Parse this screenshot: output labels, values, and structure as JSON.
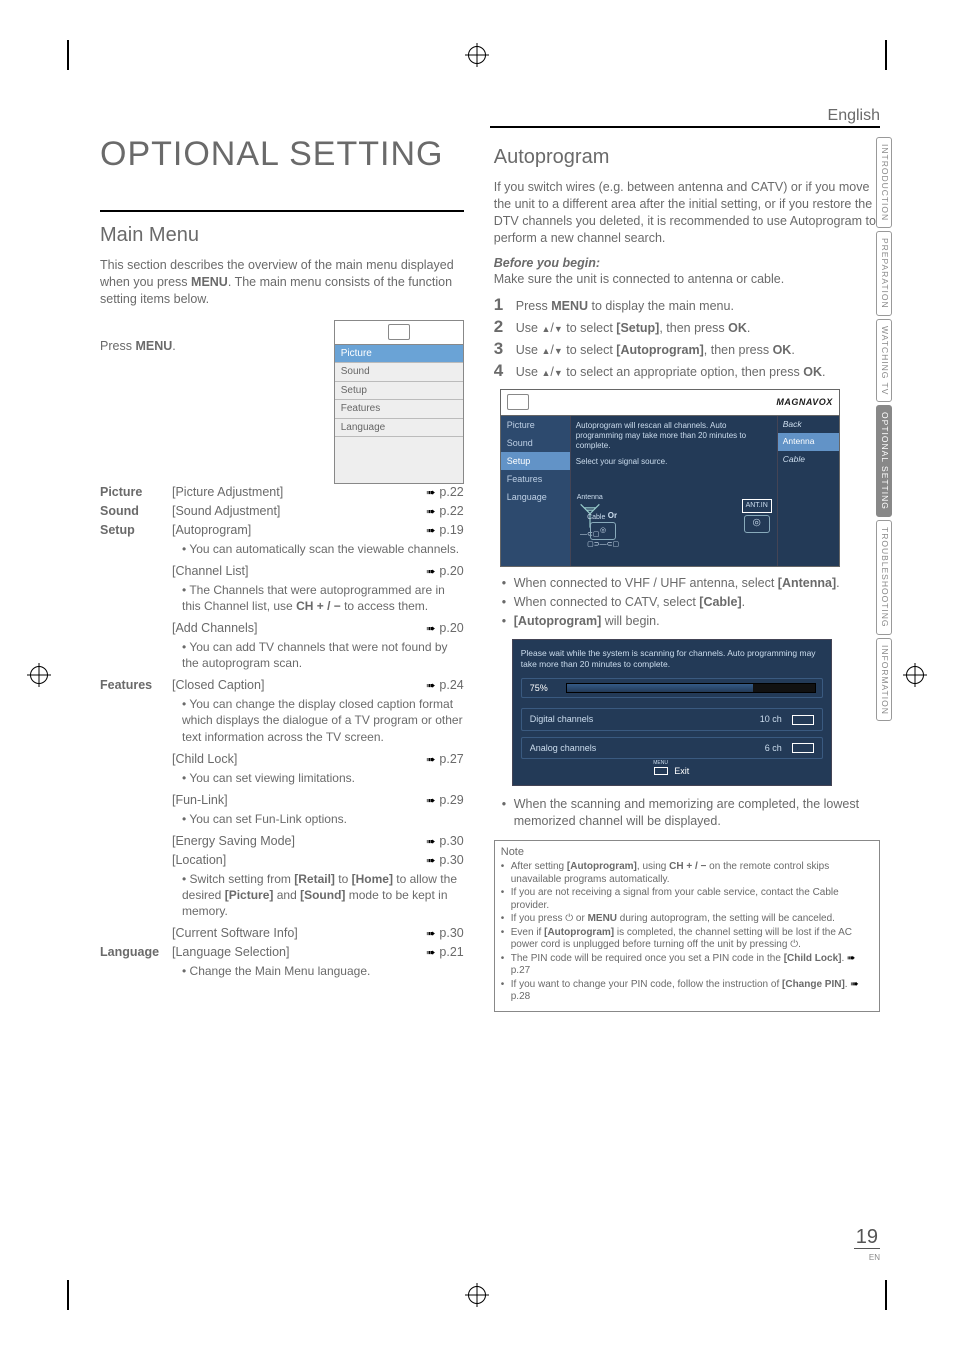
{
  "lang_label": "English",
  "title": "OPTIONAL SETTING",
  "main_menu": {
    "heading": "Main Menu",
    "intro": "This section describes the overview of the main menu displayed when you press MENU. The main menu consists of the function setting items below.",
    "press": "Press ",
    "press_btn": "MENU",
    "press_end": ".",
    "graphic_items": [
      "Picture",
      "Sound",
      "Setup",
      "Features",
      "Language"
    ],
    "rows": [
      {
        "cat": "Picture",
        "item": "[Picture Adjustment]",
        "page": "p.22"
      },
      {
        "cat": "Sound",
        "item": "[Sound Adjustment]",
        "page": "p.22"
      },
      {
        "cat": "Setup",
        "item": "[Autoprogram]",
        "page": "p.19",
        "desc": "• You can automatically scan the viewable channels."
      },
      {
        "cat": "",
        "item": "[Channel List]",
        "page": "p.20",
        "desc": "• The Channels that were autoprogrammed are in this Channel list, use CH + / − to access them."
      },
      {
        "cat": "",
        "item": "[Add Channels]",
        "page": "p.20",
        "desc": "• You can add TV channels that were not found by the autoprogram scan."
      },
      {
        "cat": "Features",
        "item": "[Closed Caption]",
        "page": "p.24",
        "desc": "• You can change the display closed caption format which displays the dialogue of a TV program or other text information across the TV screen."
      },
      {
        "cat": "",
        "item": "[Child Lock]",
        "page": "p.27",
        "desc": "• You can set viewing limitations."
      },
      {
        "cat": "",
        "item": "[Fun-Link]",
        "page": "p.29",
        "desc": "• You can set Fun-Link options."
      },
      {
        "cat": "",
        "item": "[Energy Saving Mode]",
        "page": "p.30"
      },
      {
        "cat": "",
        "item": "[Location]",
        "page": "p.30",
        "desc": "• Switch setting from [Retail] to [Home] to allow the desired [Picture] and [Sound] mode to be kept in memory."
      },
      {
        "cat": "",
        "item": "[Current Software Info]",
        "page": "p.30"
      },
      {
        "cat": "Language",
        "item": "[Language Selection]",
        "page": "p.21",
        "desc": "• Change the Main Menu language."
      }
    ]
  },
  "autoprogram": {
    "heading": "Autoprogram",
    "intro": "If you switch wires (e.g. between antenna and CATV) or if you move the unit to a different area after the initial setting, or if you restore the DTV channels you deleted, it is recommended to use Autoprogram to perform a new channel search.",
    "before_head": "Before you begin:",
    "before_body": "Make sure the unit is connected to antenna or cable.",
    "steps": [
      {
        "n": "1",
        "pre": "Press ",
        "b": "MENU",
        "post": " to display the main menu."
      },
      {
        "n": "2",
        "pre": "Use ",
        "mid": " to select ",
        "b2": "[Setup]",
        "post": ", then press ",
        "b3": "OK",
        "end": "."
      },
      {
        "n": "3",
        "pre": "Use ",
        "mid": " to select ",
        "b2": "[Autoprogram]",
        "post": ", then press ",
        "b3": "OK",
        "end": "."
      },
      {
        "n": "4",
        "pre": "Use ",
        "mid": " to select an appropriate option, then press ",
        "b3": "OK",
        "end": "."
      }
    ],
    "graphic": {
      "logo": "MAGNAVOX",
      "left": [
        "Picture",
        "Sound",
        "Setup",
        "Features",
        "Language"
      ],
      "left_sel": "Setup",
      "msg": "Autoprogram will rescan all channels. Auto programming may take more than 20 minutes to complete.",
      "label": "Select your signal source.",
      "antenna": "Antenna",
      "cable": "Cable",
      "or": "Or",
      "antin": "ANT.IN",
      "right": [
        "Back",
        "Antenna",
        "Cable"
      ],
      "right_sel": "Antenna"
    },
    "after_bullets": [
      "When connected to VHF / UHF antenna, select [Antenna].",
      "When connected to CATV, select [Cable].",
      "[Autoprogram] will begin."
    ],
    "scan": {
      "msg": "Please wait while the system is scanning for channels. Auto programming may take more than 20 minutes to complete.",
      "pct": "75%",
      "digital": "Digital channels",
      "digital_n": "10 ch",
      "analog": "Analog channels",
      "analog_n": "6 ch",
      "exit": "Exit"
    },
    "scan_done": "When the scanning and memorizing are completed, the lowest memorized channel will be displayed.",
    "note_head": "Note",
    "notes": [
      "After setting [Autoprogram], using CH + / − on the remote control skips unavailable programs automatically.",
      "If you are not receiving a signal from your cable service, contact the Cable provider.",
      "If you press ⏻ or MENU during autoprogram, the setting will be canceled.",
      "Even if [Autoprogram] is completed, the channel setting will be lost if the AC power cord is unplugged before turning off the unit by pressing ⏻.",
      "The PIN code will be required once you set a PIN code in the [Child Lock]. ➠ p.27",
      "If you want to change your PIN code, follow the instruction of [Change PIN]. ➠ p.28"
    ]
  },
  "tabs": [
    "INTRODUCTION",
    "PREPARATION",
    "WATCHING TV",
    "OPTIONAL SETTING",
    "TROUBLESHOOTING",
    "INFORMATION"
  ],
  "tabs_active": "OPTIONAL SETTING",
  "page_number": "19",
  "page_lang": "EN"
}
